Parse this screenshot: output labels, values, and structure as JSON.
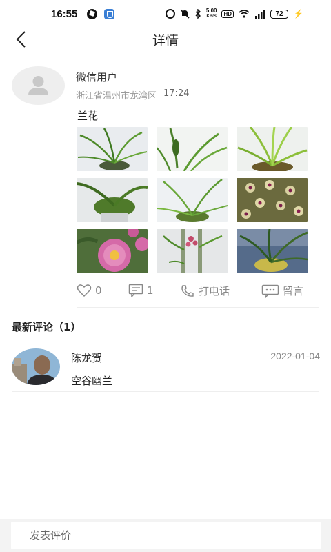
{
  "status_bar": {
    "time": "16:55",
    "net_speed_value": "5.00",
    "net_speed_unit": "KB/S",
    "hd_label": "HD",
    "battery": "72"
  },
  "header": {
    "title": "详情"
  },
  "post": {
    "user_name": "微信用户",
    "location": "浙江省温州市龙湾区",
    "time": "17:24",
    "text": "兰花",
    "photos": [
      {
        "icon": "orchid-photo",
        "bg": "#e9ecef"
      },
      {
        "icon": "orchid-photo",
        "bg": "#f2f4f2"
      },
      {
        "icon": "orchid-photo",
        "bg": "#eef1ee"
      },
      {
        "icon": "orchid-photo",
        "bg": "#e6e9ea"
      },
      {
        "icon": "orchid-photo",
        "bg": "#eef1f3"
      },
      {
        "icon": "orchid-flower-photo",
        "bg": "#6b6a3e"
      },
      {
        "icon": "peony-photo",
        "bg": "#4f6e3a"
      },
      {
        "icon": "orchid-pole-photo",
        "bg": "#e5e7e8"
      },
      {
        "icon": "orchid-pot-photo",
        "bg": "#556b8a"
      }
    ]
  },
  "actions": {
    "likes": "0",
    "comments": "1",
    "call_label": "打电话",
    "message_label": "留言"
  },
  "comments": {
    "title": "最新评论（1）",
    "items": [
      {
        "name": "陈龙贺",
        "date": "2022-01-04",
        "text": "空谷幽兰"
      }
    ]
  },
  "bottom_bar": {
    "input_placeholder": "发表评价"
  },
  "colors": {
    "accent_gray": "#888888",
    "divider": "#eeeeee",
    "bottom_bar_bg": "#f3f3f3"
  }
}
